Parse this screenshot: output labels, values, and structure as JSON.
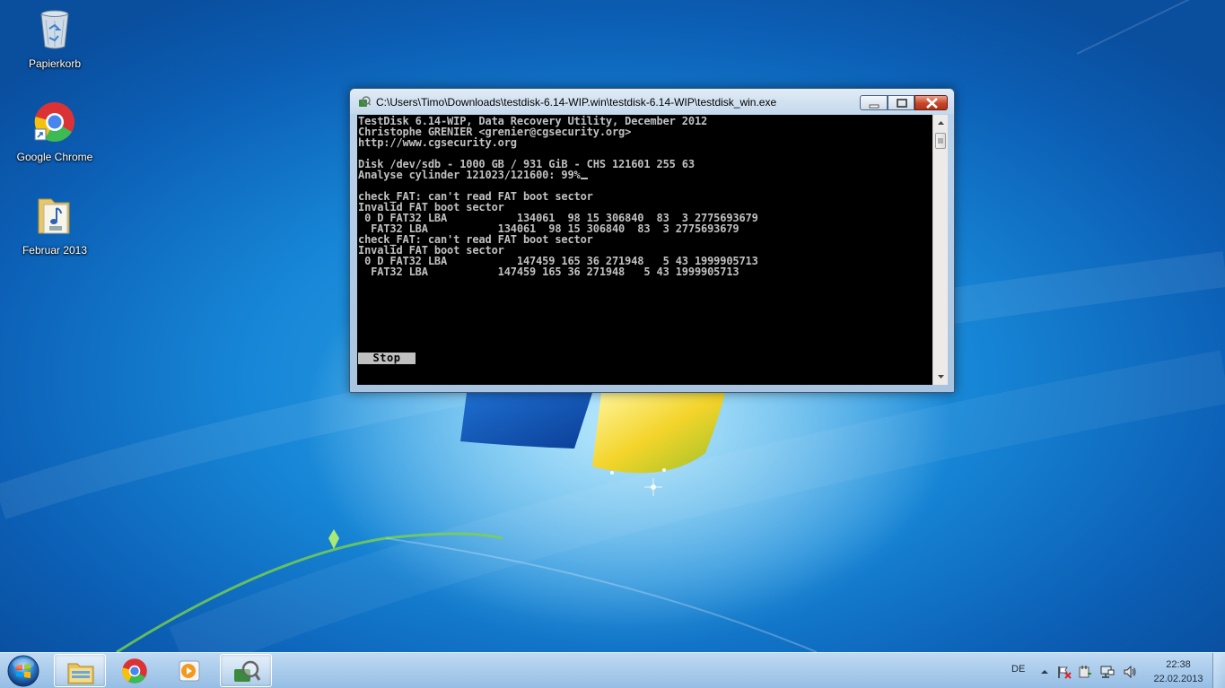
{
  "desktop": {
    "icons": [
      {
        "label": "Papierkorb",
        "icon": "recycle-bin-icon"
      },
      {
        "label": "Google Chrome",
        "icon": "chrome-icon"
      },
      {
        "label": "Februar 2013",
        "icon": "music-folder-icon"
      }
    ]
  },
  "window": {
    "title": "C:\\Users\\Timo\\Downloads\\testdisk-6.14-WIP.win\\testdisk-6.14-WIP\\testdisk_win.exe",
    "console_lines": "TestDisk 6.14-WIP, Data Recovery Utility, December 2012\nChristophe GRENIER <grenier@cgsecurity.org>\nhttp://www.cgsecurity.org\n\nDisk /dev/sdb - 1000 GB / 931 GiB - CHS 121601 255 63\nAnalyse cylinder 121023/121600: 99%",
    "console_output": "\n\ncheck_FAT: can't read FAT boot sector\nInvalid FAT boot sector\n 0 D FAT32 LBA           134061  98 15 306840  83  3 2775693679\n  FAT32 LBA           134061  98 15 306840  83  3 2775693679\ncheck_FAT: can't read FAT boot sector\nInvalid FAT boot sector\n 0 D FAT32 LBA           147459 165 36 271948   5 43 1999905713\n  FAT32 LBA           147459 165 36 271948   5 43 1999905713",
    "stop_label": "Stop"
  },
  "taskbar": {
    "items": [
      "start-orb",
      "windows-explorer",
      "google-chrome",
      "media-player",
      "testdisk"
    ],
    "language": "DE",
    "time": "22:38",
    "date": "22.02.2013"
  },
  "colors": {
    "console_bg": "#000000",
    "console_fg": "#c0c0c0",
    "close_button": "#c8452a"
  }
}
